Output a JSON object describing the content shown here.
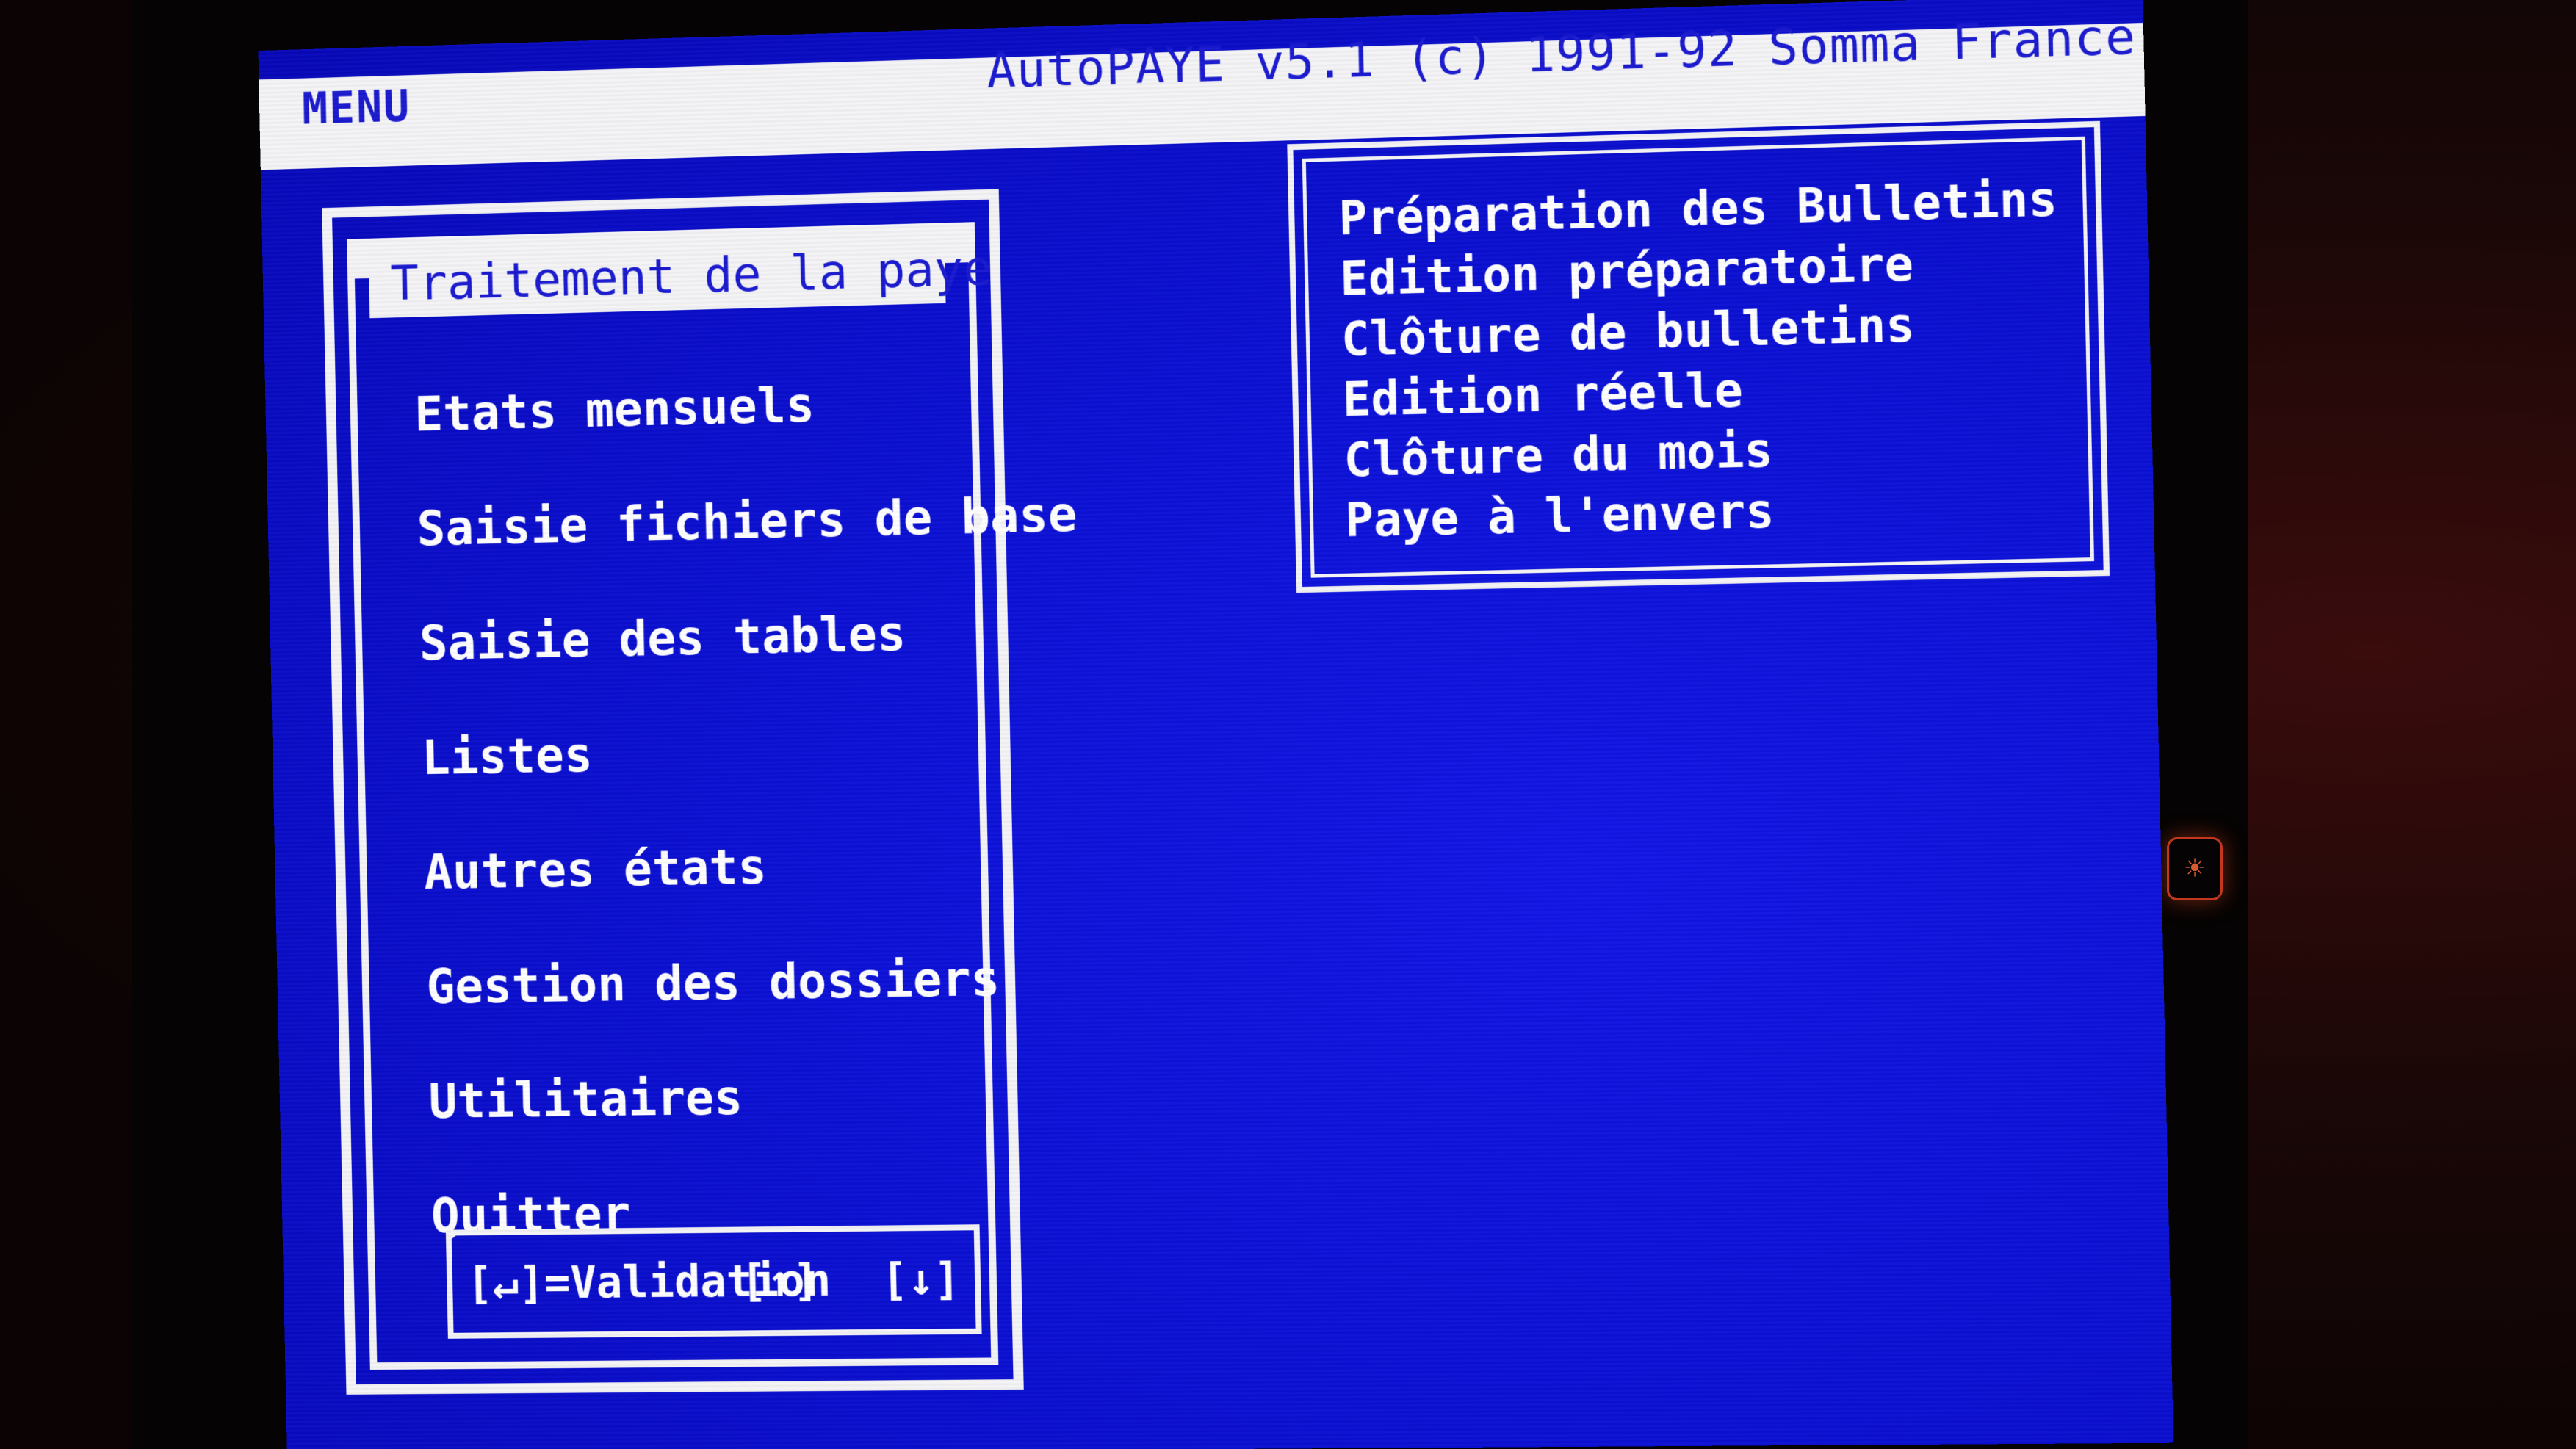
{
  "topbar": {
    "menu_label": "MENU",
    "app_title": "AutoPAYE v5.1 (c) 1991-92 Somma France"
  },
  "main_menu": {
    "title": "Traitement de la paye",
    "items": [
      {
        "label": "Etats mensuels"
      },
      {
        "label": "Saisie fichiers de base"
      },
      {
        "label": "Saisie des tables"
      },
      {
        "label": "Listes"
      },
      {
        "label": "Autres états"
      },
      {
        "label": "Gestion des dossiers"
      },
      {
        "label": "Utilitaires"
      },
      {
        "label": "Quitter"
      }
    ],
    "help": {
      "validation": "[↵]=Validation",
      "up_key": "[↑]",
      "down_key": "[↓]"
    }
  },
  "sub_menu": {
    "items": [
      {
        "label": "Préparation des Bulletins"
      },
      {
        "label": "Edition préparatoire"
      },
      {
        "label": "Clôture de bulletins"
      },
      {
        "label": "Edition réelle"
      },
      {
        "label": "Clôture du mois"
      },
      {
        "label": "Paye à l'envers"
      }
    ]
  },
  "colors": {
    "screen_blue": "#0b10d4",
    "text_white": "#ffffff",
    "bar_white": "#f4f4f6",
    "led_red": "#c2381e"
  },
  "icons": {
    "power_led": "lightbulb-icon"
  }
}
